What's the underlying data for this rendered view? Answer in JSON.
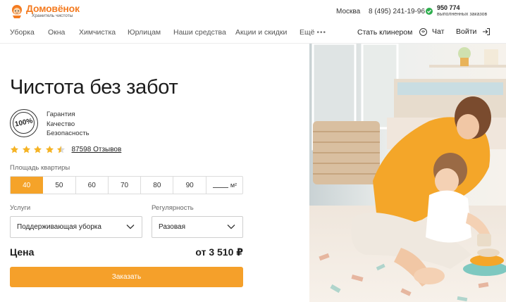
{
  "header": {
    "logo_name": "Домовёнок",
    "logo_tagline": "Хранитель чистоты",
    "city": "Москва",
    "phone": "8 (495) 241-19-96",
    "orders_count": "950 774",
    "orders_label": "выполненных заказов"
  },
  "nav": {
    "items": [
      "Уборка",
      "Окна",
      "Химчистка",
      "Юрлицам",
      "Наши средства",
      "Акции и скидки",
      "Ещё"
    ],
    "become_cleaner": "Стать клинером",
    "chat": "Чат",
    "login": "Войти"
  },
  "main": {
    "headline": "Чистота без забот",
    "badge_text": "100%",
    "features": [
      "Гарантия",
      "Качество",
      "Безопасность"
    ],
    "rating": 4.5,
    "reviews_link": "87598 Отзывов",
    "area_label": "Площадь квартиры",
    "area_options": [
      "40",
      "50",
      "60",
      "70",
      "80",
      "90"
    ],
    "area_selected": "40",
    "area_unit": "м²",
    "services_label": "Услуги",
    "services_value": "Поддерживающая уборка",
    "regularity_label": "Регулярность",
    "regularity_value": "Разовая",
    "price_label": "Цена",
    "price_value": "от 3 510 ₽",
    "order_button": "Заказать"
  },
  "colors": {
    "brand_orange": "#f47b20",
    "button_orange": "#f5a02a",
    "star": "#f5b324",
    "check_green": "#2eae4e"
  }
}
